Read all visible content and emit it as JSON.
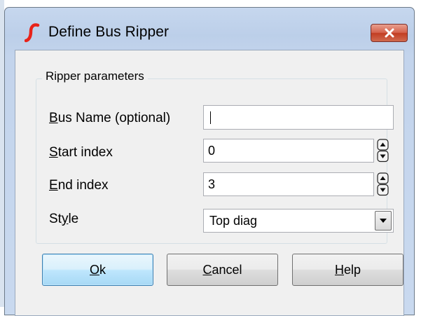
{
  "window": {
    "title": "Define Bus Ripper"
  },
  "group": {
    "title": "Ripper parameters"
  },
  "fields": {
    "bus_name": {
      "mnemonic": "B",
      "label_rest": "us Name (optional)",
      "value": ""
    },
    "start_index": {
      "mnemonic": "S",
      "label_rest": "tart index",
      "value": "0"
    },
    "end_index": {
      "mnemonic": "E",
      "label_rest": "nd index",
      "value": "3"
    },
    "style": {
      "label_pre": "St",
      "mnemonic": "y",
      "label_post": "le",
      "value": "Top diag"
    }
  },
  "buttons": {
    "ok": {
      "mnemonic": "O",
      "rest": "k"
    },
    "cancel": {
      "mnemonic": "C",
      "rest": "ancel"
    },
    "help": {
      "mnemonic": "H",
      "rest": "elp"
    }
  },
  "colors": {
    "titlebar": "#bccfe9",
    "close_button": "#c23d22",
    "default_button": "#bee6fd",
    "app_icon": "#e8231a"
  }
}
